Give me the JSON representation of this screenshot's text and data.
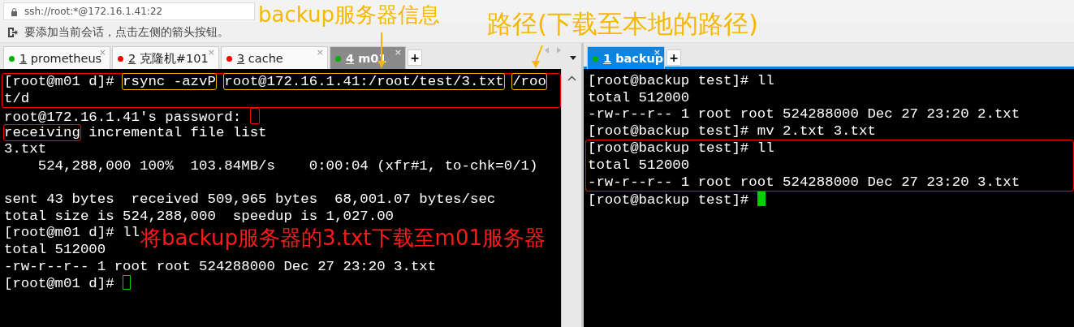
{
  "address_bar": {
    "text": "ssh://root:*@172.16.1.41:22"
  },
  "hint_bar": {
    "text": "要添加当前会话，点击左侧的箭头按钮。"
  },
  "left_pane": {
    "new_tab": "+",
    "tabs": [
      {
        "number": "1",
        "label": "prometheus",
        "color": "#00b000",
        "close": "×",
        "selected": false
      },
      {
        "number": "2",
        "label": "克隆机#101",
        "color": "#ff0000",
        "close": "×",
        "selected": false
      },
      {
        "number": "3",
        "label": "cache",
        "color": "#ff0000",
        "close": "×",
        "selected": false
      },
      {
        "number": "4",
        "label": "m01",
        "color": "#00b000",
        "close": "×",
        "selected": true
      }
    ],
    "terminal": [
      {
        "color": "#ff0000",
        "lines": [
          [
            {
              "kind": "text",
              "text": "[root@m01 d]# "
            },
            {
              "kind": "text",
              "text": "rsync -azvP",
              "color": "#f0b400"
            },
            {
              "kind": "text",
              "text": "root@172.16.1.41:/root/test/3.txt",
              "color": "#f0b400"
            },
            {
              "kind": "text",
              "text": "/roo",
              "color": "#f0b400"
            }
          ],
          [
            {
              "kind": "text",
              "text": "t/d"
            }
          ]
        ]
      },
      {
        "lines": [
          [
            {
              "kind": "text",
              "text": "root@172.16.1.41's password: "
            },
            {
              "kind": "mark",
              "color": "#ff0000"
            }
          ],
          [
            {
              "kind": "text",
              "text": "receiving",
              "color": "#ff0000"
            },
            {
              "kind": "text",
              "text": " incremental file list"
            }
          ],
          [
            {
              "kind": "text",
              "text": "3.txt"
            }
          ],
          [
            {
              "kind": "text",
              "text": "    524,288,000 100%  103.84MB/s    0:00:04 (xfr#1, to-chk=0/1)"
            }
          ]
        ]
      },
      {
        "gap_before": true,
        "lines": [
          [
            {
              "kind": "text",
              "text": "sent 43 bytes  received 509,965 bytes  68,001.07 bytes/sec"
            }
          ],
          [
            {
              "kind": "text",
              "text": "total size is 524,288,000  speedup is 1,027.00"
            }
          ],
          [
            {
              "kind": "text",
              "text": "[root@m01 d]# ll"
            }
          ],
          [
            {
              "kind": "text",
              "text": "total 512000"
            }
          ],
          [
            {
              "kind": "text",
              "text": "-rw-r--r-- 1 root root 524288000 Dec 27 23:20 3.txt"
            }
          ],
          [
            {
              "kind": "text",
              "text": "[root@m01 d]# "
            },
            {
              "kind": "cursor",
              "filled": false
            }
          ]
        ]
      }
    ]
  },
  "right_pane": {
    "new_tab": "+",
    "tabs": [
      {
        "number": "1",
        "label": "backup",
        "color": "#00b000",
        "close": "×",
        "selected": true
      }
    ],
    "terminal": [
      {
        "lines": [
          [
            {
              "kind": "text",
              "text": "[root@backup test]# ll"
            }
          ],
          [
            {
              "kind": "text",
              "text": "total 512000"
            }
          ],
          [
            {
              "kind": "text",
              "text": "-rw-r--r-- 1 root root 524288000 Dec 27 23:20 2.txt"
            }
          ],
          [
            {
              "kind": "text",
              "text": "[root@backup test]# mv 2.txt 3.txt"
            }
          ]
        ]
      },
      {
        "color": "#ff0000",
        "lines": [
          [
            {
              "kind": "text",
              "text": "[root@backup test]# ll"
            }
          ],
          [
            {
              "kind": "text",
              "text": "total 512000"
            }
          ],
          [
            {
              "kind": "text",
              "text": "-rw-r--r-- 1 root root 524288000 Dec 27 23:20 3.txt"
            }
          ]
        ]
      },
      {
        "lines": [
          [
            {
              "kind": "text",
              "text": "[root@backup test]# "
            },
            {
              "kind": "cursor",
              "filled": true
            }
          ]
        ]
      }
    ]
  },
  "annotations": [
    {
      "kind": "label",
      "text": "backup服务器信息",
      "color": "#f5b800"
    },
    {
      "kind": "label",
      "text": "路径(下载至本地的路径)",
      "color": "#f5b800"
    },
    {
      "kind": "label",
      "text": "将backup服务器的3.txt下载至m01服务器",
      "color": "#ff1a1a"
    },
    {
      "kind": "arrow",
      "color": "#f5b800"
    },
    {
      "kind": "arrow",
      "color": "#f5b800"
    }
  ]
}
